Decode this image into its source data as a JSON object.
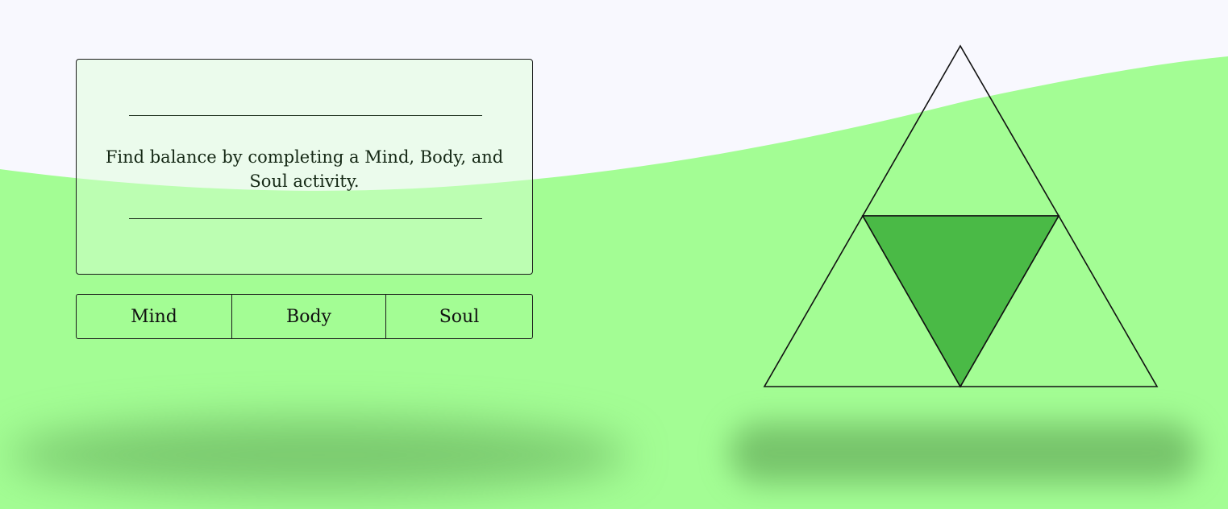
{
  "colors": {
    "background_top": "#f8f8fe",
    "background_green": "#a3fd94",
    "triangle_center_fill": "#4aba46",
    "card_border": "#1a1a1a"
  },
  "card": {
    "message": "Find balance by completing a Mind, Body, and Soul activity."
  },
  "tabs": [
    {
      "label": "Mind"
    },
    {
      "label": "Body"
    },
    {
      "label": "Soul"
    }
  ],
  "triforce": {
    "segments": [
      "top",
      "center",
      "bottom-left",
      "bottom-right"
    ],
    "active_segment": "center"
  }
}
